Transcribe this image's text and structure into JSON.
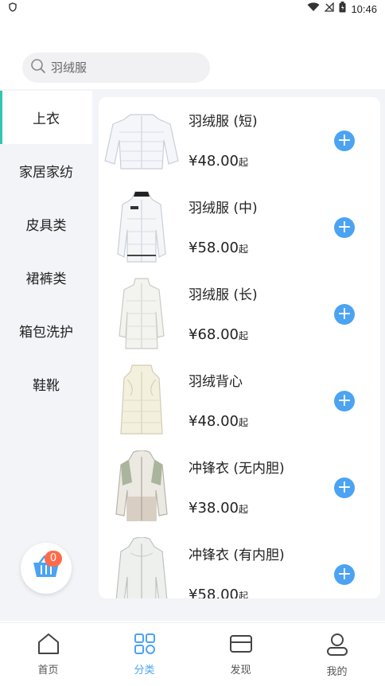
{
  "status": {
    "time": "10:46"
  },
  "search": {
    "placeholder": "羽绒服"
  },
  "sidebar": {
    "items": [
      {
        "label": "上衣",
        "active": true
      },
      {
        "label": "家居家纺"
      },
      {
        "label": "皮具类"
      },
      {
        "label": "裙裤类"
      },
      {
        "label": "箱包洗护"
      },
      {
        "label": "鞋靴"
      }
    ]
  },
  "products": [
    {
      "name": "羽绒服 (短)",
      "price": "¥48.00",
      "suffix": "起"
    },
    {
      "name": "羽绒服 (中)",
      "price": "¥58.00",
      "suffix": "起"
    },
    {
      "name": "羽绒服 (长)",
      "price": "¥68.00",
      "suffix": "起"
    },
    {
      "name": "羽绒背心",
      "price": "¥48.00",
      "suffix": "起"
    },
    {
      "name": "冲锋衣 (无内胆)",
      "price": "¥38.00",
      "suffix": "起"
    },
    {
      "name": "冲锋衣 (有内胆)",
      "price": "¥58.00",
      "suffix": "起"
    }
  ],
  "cart": {
    "count": "0"
  },
  "tabbar": {
    "tabs": [
      {
        "label": "首页"
      },
      {
        "label": "分类",
        "active": true
      },
      {
        "label": "发现"
      },
      {
        "label": "我的"
      }
    ]
  },
  "colors": {
    "accent": "#4ba3f2",
    "sidebar_indicator": "#34c5b0",
    "badge": "#ff6b4a"
  }
}
